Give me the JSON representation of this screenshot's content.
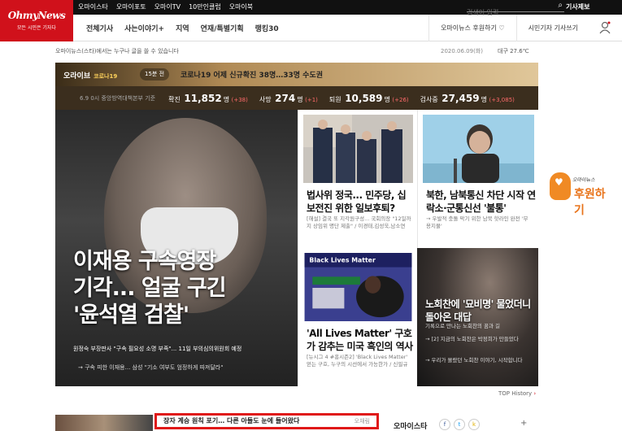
{
  "brand": {
    "name": "OhmyNews",
    "tagline": "모든 시민은 기자다"
  },
  "toplinks": [
    "오마이스타",
    "오마이포토",
    "오마이TV",
    "10만인클럽",
    "오마이북"
  ],
  "search": {
    "placeholder": "검색어 입력"
  },
  "report_label": "기사제보",
  "nav": {
    "items": [
      "전체기사",
      "사는이야기+",
      "지역",
      "연재/특별기획",
      "랭킹30"
    ],
    "support": "오마이뉴스 후원하기 ♡",
    "citizen": "시민기자 기사쓰기"
  },
  "notice": "오마이뉴스(스타)에서는 누구나 글을 쓸 수 있습니다",
  "date": "2020.06.09(화)",
  "weather": "대구 27.6℃",
  "covid": {
    "brand": "오라이브",
    "brand_sub": "코로나19",
    "pill": "15분 전",
    "headline": "코로나19 어제 신규확진 38명…33명 수도권",
    "source": "6.9 0시 중앙방역대책본부 기준",
    "stats": [
      {
        "label": "확진",
        "value": "11,852",
        "unit": "명",
        "delta": "(+38)"
      },
      {
        "label": "사망",
        "value": "274",
        "unit": "명",
        "delta": "(+1)"
      },
      {
        "label": "퇴원",
        "value": "10,589",
        "unit": "명",
        "delta": "(+26)"
      },
      {
        "label": "검사중",
        "value": "27,459",
        "unit": "명",
        "delta": "(+3,085)"
      }
    ]
  },
  "hero": {
    "title_l1": "이재용 구속영장",
    "title_l2": "기각... 얼굴 구긴",
    "title_l3": "'윤석열 검찰'",
    "sub1": "원정숙 부장판사 \"구속 필요성 소명 부족\"... 11일 부의심의위원회 예정",
    "sub2": "→ 구속 피한 이재용... 삼성 \"기소 여부도 엄정하게 따져달라\""
  },
  "cards": [
    {
      "title": "법사위 정국... 민주당, 십보전진 위한 일보후퇴?",
      "desc": "[해설] 결국 또 지각원구성... 국회의장 \"12일까지 상임위 명단 제출\" / 이경태,김성욱,남소연"
    },
    {
      "title": "북한, 남북통신 차단 시작 연락소·군통신선 '불통'",
      "desc": "→ 우발적 충돌 막기 위한 남북 핫라인 완전 '무용지물'"
    },
    {
      "title": "'All Lives Matter' 구호가 감추는 미국 흑인의 역사",
      "desc": "[뉴시그 4 #흥시즌2] 'Black Lives Matter' 얻는 구호, 누구의 시선에서 가능한가 / 신필규"
    },
    {
      "title": "노회찬에 '묘비명' 물었더니 돌아온 대답",
      "desc": "기록으로 만나는 노회찬의 꿈과 길",
      "desc2": "→ [2] 지금의 노회찬은 박정희가 만들었다",
      "desc3": "→ 우리가 몰랐던 노회찬 이야기, 시작합니다"
    }
  ],
  "photo_sign": "Black Lives Matter",
  "history": "TOP History",
  "breaking": {
    "text": "장자 계승 원칙 포기… 다른 아들도 눈에 들어왔다",
    "who": "오채림"
  },
  "bottom_label": "오마이스타",
  "support_badge": {
    "t1": "오마이뉴스",
    "t2": "후원하기"
  }
}
